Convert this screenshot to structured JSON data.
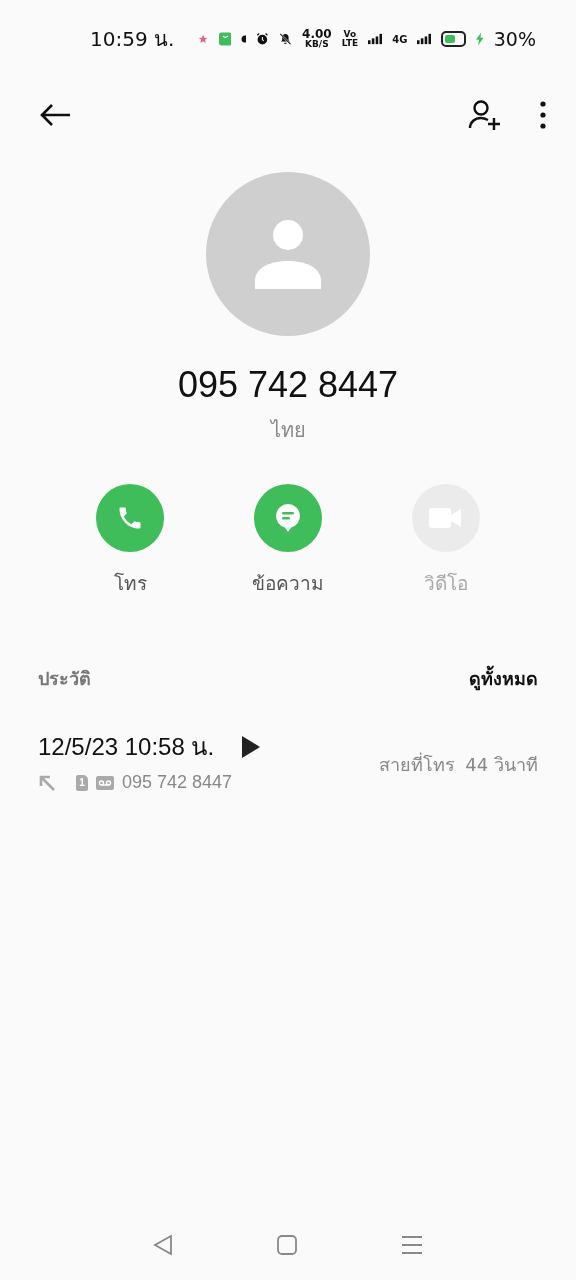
{
  "status_bar": {
    "time": "10:59 น.",
    "speed": "4.00",
    "speed_unit": "KB/S",
    "volte_top": "Vo",
    "volte_bottom": "LTE",
    "network": "4G",
    "battery": "30%",
    "charging": true
  },
  "contact": {
    "number": "095 742 8447",
    "location": "ไทย"
  },
  "actions": [
    {
      "kind": "call",
      "label": "โทร",
      "disabled": false
    },
    {
      "kind": "message",
      "label": "ข้อความ",
      "disabled": false
    },
    {
      "kind": "video",
      "label": "วิดีโอ",
      "disabled": true
    }
  ],
  "history": {
    "title": "ประวัติ",
    "see_all": "ดูทั้งหมด",
    "entries": [
      {
        "datetime": "12/5/23 10:58 น.",
        "sim": "1",
        "number": "095 742 8447",
        "type": "สายที่โทร",
        "duration": "44 วินาที",
        "recorded": true
      }
    ]
  }
}
